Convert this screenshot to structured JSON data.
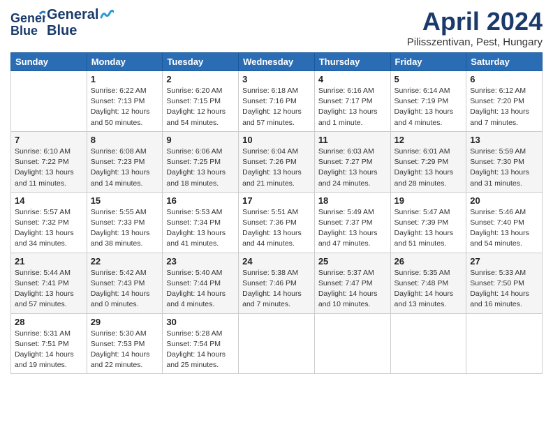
{
  "header": {
    "logo": {
      "line1": "General",
      "line2": "Blue"
    },
    "title": "April 2024",
    "location": "Pilisszentivan, Pest, Hungary"
  },
  "weekdays": [
    "Sunday",
    "Monday",
    "Tuesday",
    "Wednesday",
    "Thursday",
    "Friday",
    "Saturday"
  ],
  "weeks": [
    [
      {
        "day": "",
        "info": ""
      },
      {
        "day": "1",
        "info": "Sunrise: 6:22 AM\nSunset: 7:13 PM\nDaylight: 12 hours\nand 50 minutes."
      },
      {
        "day": "2",
        "info": "Sunrise: 6:20 AM\nSunset: 7:15 PM\nDaylight: 12 hours\nand 54 minutes."
      },
      {
        "day": "3",
        "info": "Sunrise: 6:18 AM\nSunset: 7:16 PM\nDaylight: 12 hours\nand 57 minutes."
      },
      {
        "day": "4",
        "info": "Sunrise: 6:16 AM\nSunset: 7:17 PM\nDaylight: 13 hours\nand 1 minute."
      },
      {
        "day": "5",
        "info": "Sunrise: 6:14 AM\nSunset: 7:19 PM\nDaylight: 13 hours\nand 4 minutes."
      },
      {
        "day": "6",
        "info": "Sunrise: 6:12 AM\nSunset: 7:20 PM\nDaylight: 13 hours\nand 7 minutes."
      }
    ],
    [
      {
        "day": "7",
        "info": "Sunrise: 6:10 AM\nSunset: 7:22 PM\nDaylight: 13 hours\nand 11 minutes."
      },
      {
        "day": "8",
        "info": "Sunrise: 6:08 AM\nSunset: 7:23 PM\nDaylight: 13 hours\nand 14 minutes."
      },
      {
        "day": "9",
        "info": "Sunrise: 6:06 AM\nSunset: 7:25 PM\nDaylight: 13 hours\nand 18 minutes."
      },
      {
        "day": "10",
        "info": "Sunrise: 6:04 AM\nSunset: 7:26 PM\nDaylight: 13 hours\nand 21 minutes."
      },
      {
        "day": "11",
        "info": "Sunrise: 6:03 AM\nSunset: 7:27 PM\nDaylight: 13 hours\nand 24 minutes."
      },
      {
        "day": "12",
        "info": "Sunrise: 6:01 AM\nSunset: 7:29 PM\nDaylight: 13 hours\nand 28 minutes."
      },
      {
        "day": "13",
        "info": "Sunrise: 5:59 AM\nSunset: 7:30 PM\nDaylight: 13 hours\nand 31 minutes."
      }
    ],
    [
      {
        "day": "14",
        "info": "Sunrise: 5:57 AM\nSunset: 7:32 PM\nDaylight: 13 hours\nand 34 minutes."
      },
      {
        "day": "15",
        "info": "Sunrise: 5:55 AM\nSunset: 7:33 PM\nDaylight: 13 hours\nand 38 minutes."
      },
      {
        "day": "16",
        "info": "Sunrise: 5:53 AM\nSunset: 7:34 PM\nDaylight: 13 hours\nand 41 minutes."
      },
      {
        "day": "17",
        "info": "Sunrise: 5:51 AM\nSunset: 7:36 PM\nDaylight: 13 hours\nand 44 minutes."
      },
      {
        "day": "18",
        "info": "Sunrise: 5:49 AM\nSunset: 7:37 PM\nDaylight: 13 hours\nand 47 minutes."
      },
      {
        "day": "19",
        "info": "Sunrise: 5:47 AM\nSunset: 7:39 PM\nDaylight: 13 hours\nand 51 minutes."
      },
      {
        "day": "20",
        "info": "Sunrise: 5:46 AM\nSunset: 7:40 PM\nDaylight: 13 hours\nand 54 minutes."
      }
    ],
    [
      {
        "day": "21",
        "info": "Sunrise: 5:44 AM\nSunset: 7:41 PM\nDaylight: 13 hours\nand 57 minutes."
      },
      {
        "day": "22",
        "info": "Sunrise: 5:42 AM\nSunset: 7:43 PM\nDaylight: 14 hours\nand 0 minutes."
      },
      {
        "day": "23",
        "info": "Sunrise: 5:40 AM\nSunset: 7:44 PM\nDaylight: 14 hours\nand 4 minutes."
      },
      {
        "day": "24",
        "info": "Sunrise: 5:38 AM\nSunset: 7:46 PM\nDaylight: 14 hours\nand 7 minutes."
      },
      {
        "day": "25",
        "info": "Sunrise: 5:37 AM\nSunset: 7:47 PM\nDaylight: 14 hours\nand 10 minutes."
      },
      {
        "day": "26",
        "info": "Sunrise: 5:35 AM\nSunset: 7:48 PM\nDaylight: 14 hours\nand 13 minutes."
      },
      {
        "day": "27",
        "info": "Sunrise: 5:33 AM\nSunset: 7:50 PM\nDaylight: 14 hours\nand 16 minutes."
      }
    ],
    [
      {
        "day": "28",
        "info": "Sunrise: 5:31 AM\nSunset: 7:51 PM\nDaylight: 14 hours\nand 19 minutes."
      },
      {
        "day": "29",
        "info": "Sunrise: 5:30 AM\nSunset: 7:53 PM\nDaylight: 14 hours\nand 22 minutes."
      },
      {
        "day": "30",
        "info": "Sunrise: 5:28 AM\nSunset: 7:54 PM\nDaylight: 14 hours\nand 25 minutes."
      },
      {
        "day": "",
        "info": ""
      },
      {
        "day": "",
        "info": ""
      },
      {
        "day": "",
        "info": ""
      },
      {
        "day": "",
        "info": ""
      }
    ]
  ]
}
